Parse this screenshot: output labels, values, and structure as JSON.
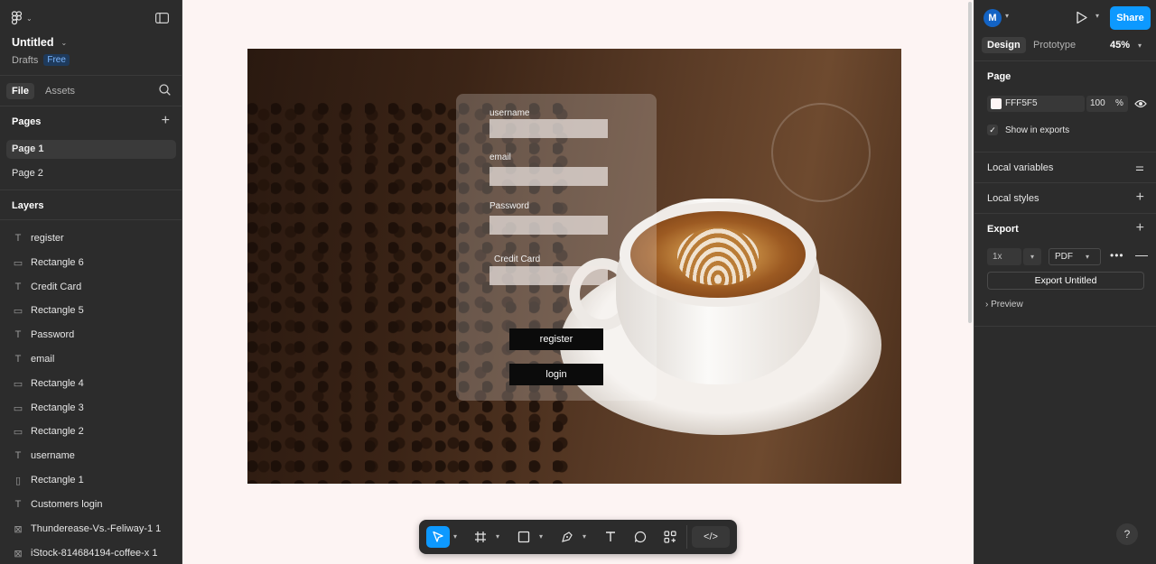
{
  "app": {
    "file_title": "Untitled",
    "location": "Drafts",
    "plan_badge": "Free"
  },
  "left_tabs": [
    "File",
    "Assets"
  ],
  "pages": {
    "title": "Pages",
    "items": [
      "Page 1",
      "Page 2"
    ]
  },
  "layers": {
    "title": "Layers",
    "items": [
      {
        "name": "register",
        "icon": "text-icon"
      },
      {
        "name": "Rectangle 6",
        "icon": "rectangle-line-icon"
      },
      {
        "name": "Credit Card",
        "icon": "text-icon"
      },
      {
        "name": "Rectangle 5",
        "icon": "rectangle-line-icon"
      },
      {
        "name": "Password",
        "icon": "text-icon"
      },
      {
        "name": "email",
        "icon": "text-icon"
      },
      {
        "name": "Rectangle 4",
        "icon": "rectangle-line-icon"
      },
      {
        "name": "Rectangle 3",
        "icon": "rectangle-line-icon"
      },
      {
        "name": "Rectangle 2",
        "icon": "rectangle-line-icon"
      },
      {
        "name": "username",
        "icon": "text-icon"
      },
      {
        "name": "Rectangle 1",
        "icon": "rectangle-icon"
      },
      {
        "name": "Customers login",
        "icon": "text-icon"
      },
      {
        "name": "Thunderease-Vs.-Feliway-1 1",
        "icon": "image-icon"
      },
      {
        "name": "iStock-814684194-coffee-x 1",
        "icon": "image-icon"
      }
    ]
  },
  "canvas": {
    "form": {
      "username_label": "username",
      "email_label": "email",
      "password_label": "Password",
      "credit_label": "Credit Card",
      "register_label": "register",
      "login_label": "login"
    }
  },
  "toolbar": {
    "tools": [
      "move-tool",
      "frame-tool",
      "rectangle-tool",
      "pen-tool",
      "text-tool",
      "comment-tool",
      "actions-tool"
    ],
    "dev_mode_label": "</>"
  },
  "right": {
    "avatar_initial": "M",
    "share_label": "Share",
    "tabs": [
      "Design",
      "Prototype"
    ],
    "zoom": "45%",
    "page_section": "Page",
    "bg_hex": "FFF5F5",
    "bg_opacity": "100",
    "percent": "%",
    "show_in_exports": "Show in exports",
    "local_variables": "Local variables",
    "local_styles": "Local styles",
    "export_section": "Export",
    "export_scale": "1x",
    "export_format": "PDF",
    "export_button": "Export Untitled",
    "preview": "Preview",
    "help": "?"
  },
  "colors": {
    "accent": "#0d99ff",
    "canvas_bg": "#fdf4f3",
    "panel_bg": "#2c2c2c"
  }
}
